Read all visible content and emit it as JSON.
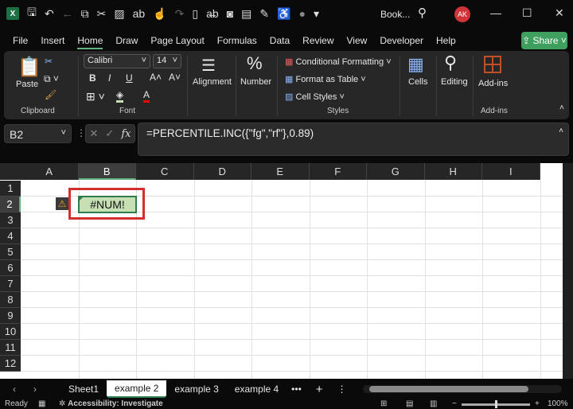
{
  "app": {
    "title": "Book...",
    "user_initials": "AK"
  },
  "quick_access": [
    "save-icon",
    "undo-icon",
    "copy-icon",
    "cut-icon",
    "format-icon",
    "spelling-icon",
    "touch-icon",
    "redo-icon",
    "new-icon",
    "strikethrough-icon",
    "camera-icon",
    "print-preview-icon",
    "form-icon",
    "accessibility-icon",
    "record-icon",
    "customize-icon"
  ],
  "menu_tabs": [
    "File",
    "Insert",
    "Home",
    "Draw",
    "Page Layout",
    "Formulas",
    "Data",
    "Review",
    "View",
    "Developer",
    "Help"
  ],
  "active_tab": "Home",
  "share_label": "Share",
  "ribbon": {
    "clipboard": {
      "paste": "Paste",
      "label": "Clipboard"
    },
    "font": {
      "name": "Calibri",
      "size": "14",
      "bold": "B",
      "italic": "I",
      "underline": "U",
      "label": "Font"
    },
    "alignment": "Alignment",
    "number": "Number",
    "styles": {
      "conditional": "Conditional Formatting",
      "table": "Format as Table",
      "cell": "Cell Styles",
      "label": "Styles"
    },
    "cells": "Cells",
    "editing": "Editing",
    "addins": {
      "button": "Add-ins",
      "label": "Add-ins"
    }
  },
  "formula_bar": {
    "name_box": "B2",
    "formula": "=PERCENTILE.INC({\"fg\",\"rf\"},0.89)"
  },
  "columns": [
    "A",
    "B",
    "C",
    "D",
    "E",
    "F",
    "G",
    "H",
    "I"
  ],
  "rows": [
    "1",
    "2",
    "3",
    "4",
    "5",
    "6",
    "7",
    "8",
    "9",
    "10",
    "11",
    "12"
  ],
  "selected_cell": {
    "ref": "B2",
    "value": "#NUM!",
    "fill": "#c6e0b4",
    "highlight": "#d32f2f"
  },
  "sheets": [
    "Sheet1",
    "example 2",
    "example 3",
    "example 4"
  ],
  "active_sheet": "example 2",
  "status": {
    "ready": "Ready",
    "accessibility": "Accessibility: Investigate",
    "zoom": "100%"
  }
}
